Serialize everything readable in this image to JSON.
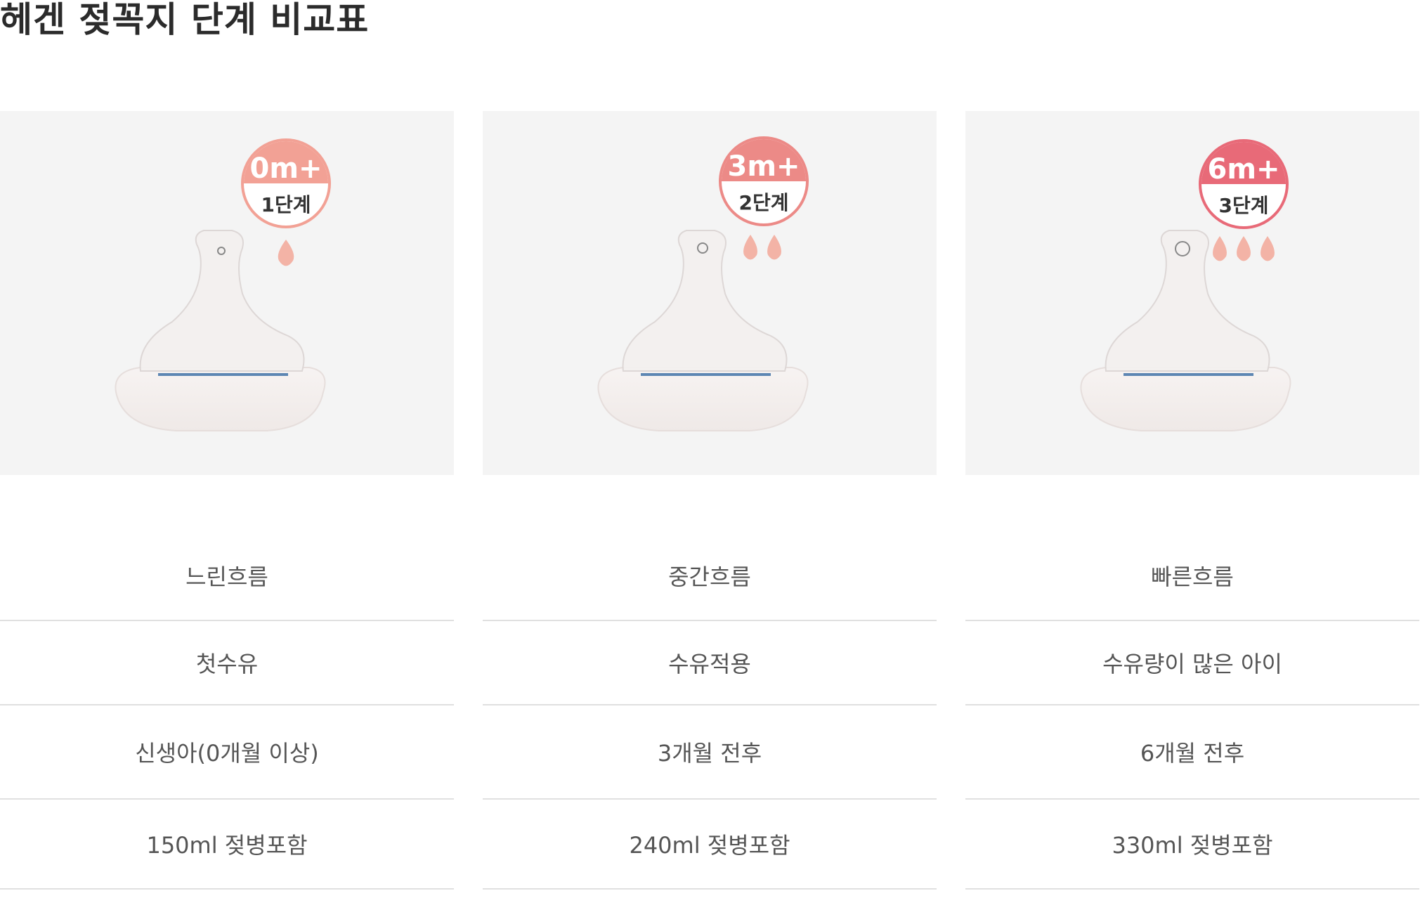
{
  "page": {
    "title": "헤겐 젖꼭지 단계 비교표"
  },
  "colors": {
    "photo_bg": "#f4f4f4",
    "badge_1": "#f2a195",
    "badge_2": "#ec8a87",
    "badge_3": "#e86a78",
    "drop": "#f3b3a6",
    "divider": "#e0e0e0"
  },
  "stages": [
    {
      "badge_age": "0m+",
      "badge_step": "1단계",
      "drops": 1,
      "flow": "느린흐름",
      "usage": "첫수유",
      "age": "신생아(0개월 이상)",
      "set": "150ml 젖병포함"
    },
    {
      "badge_age": "3m+",
      "badge_step": "2단계",
      "drops": 2,
      "flow": "중간흐름",
      "usage": "수유적용",
      "age": "3개월 전후",
      "set": "240ml 젖병포함"
    },
    {
      "badge_age": "6m+",
      "badge_step": "3단계",
      "drops": 3,
      "flow": "빠른흐름",
      "usage": "수유량이 많은 아이",
      "age": "6개월 전후",
      "set": "330ml 젖병포함"
    }
  ]
}
